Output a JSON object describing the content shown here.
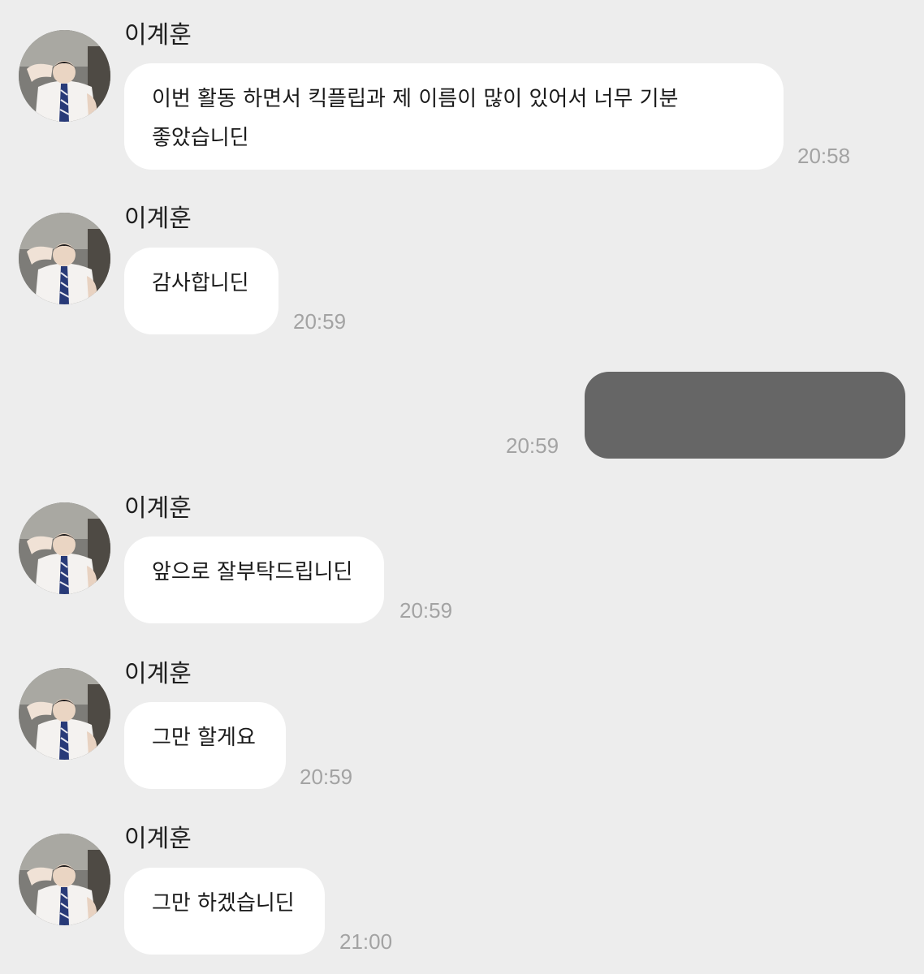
{
  "messages": [
    {
      "sender": "이계훈",
      "text": "이번 활동 하면서 킥플립과 제 이름이 많이 있어서 너무 기분 좋았습니딘",
      "time": "20:58"
    },
    {
      "sender": "이계훈",
      "text": "감사합니딘",
      "time": "20:59"
    },
    {
      "sender": "",
      "text": "",
      "time": "20:59",
      "redacted": true
    },
    {
      "sender": "이계훈",
      "text": "앞으로 잘부탁드립니딘",
      "time": "20:59"
    },
    {
      "sender": "이계훈",
      "text": "그만 할게요",
      "time": "20:59"
    },
    {
      "sender": "이계훈",
      "text": "그만 하겠습니딘",
      "time": "21:00"
    }
  ],
  "colors": {
    "background": "#ededed",
    "incoming_bubble": "#ffffff",
    "redacted_bubble": "#666666",
    "timestamp": "#a3a3a3"
  },
  "icons": {
    "avatar": "profile-photo"
  }
}
